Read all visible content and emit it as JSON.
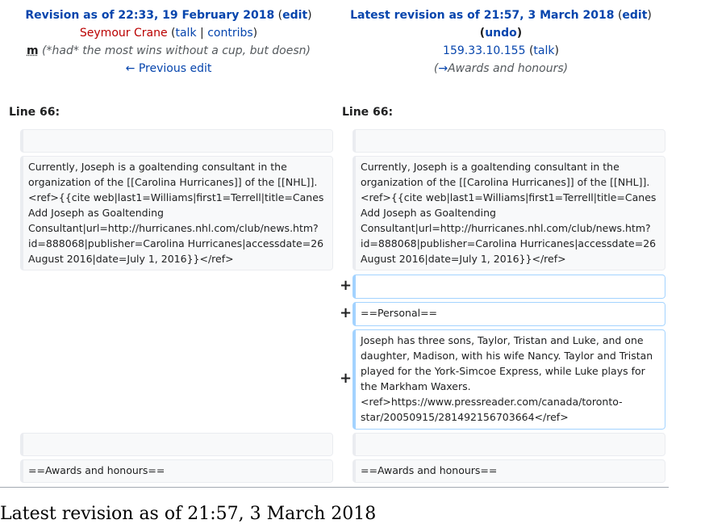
{
  "left_header": {
    "title": "Revision as of 22:33, 19 February 2018",
    "edit": "edit",
    "user": "Seymour Crane",
    "talk": "talk",
    "contribs": "contribs",
    "minor_flag": "m",
    "summary": "(*had* the most wins without a cup, but doesn)",
    "prev_edit": "← Previous edit"
  },
  "right_header": {
    "title": "Latest revision as of 21:57, 3 March 2018",
    "edit": "edit",
    "undo": "undo",
    "user": "159.33.10.155",
    "talk": "talk",
    "summary_arrow": "→",
    "summary": "Awards and honours"
  },
  "line_number": "Line 66:",
  "context_text": "Currently, Joseph is a goaltending consultant in the organization of the [[Carolina Hurricanes]] of the [[NHL]].<ref>{{cite web|last1=Williams|first1=Terrell|title=Canes Add Joseph as Goaltending Consultant|url=http://hurricanes.nhl.com/club/news.htm?id=888068|publisher=Carolina Hurricanes|accessdate=26 August 2016|date=July 1, 2016}}</ref>",
  "added": {
    "marker": "+",
    "blank": "",
    "heading": "==Personal==",
    "paragraph": "Joseph has three sons, Taylor, Tristan and Luke, and one daughter, Madison, with his wife Nancy. Taylor and Tristan played for the York-Simcoe Express, while Luke plays for the Markham Waxers.<ref>https://www.pressreader.com/canada/toronto-star/20050915/281492156703664</ref>"
  },
  "awards_heading": "==Awards and honours==",
  "footer_title": "Latest revision as of 21:57, 3 March 2018"
}
